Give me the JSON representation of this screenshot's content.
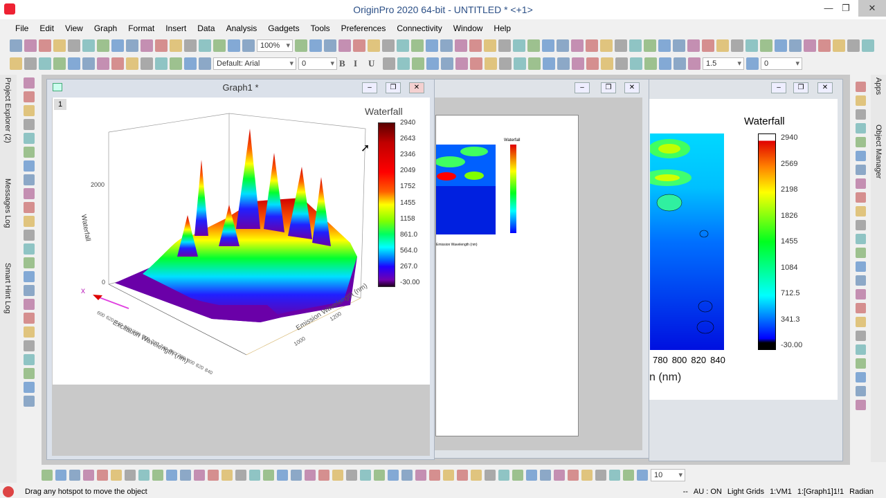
{
  "app": {
    "title": "OriginPro 2020 64-bit - UNTITLED * <+1>",
    "controls": [
      "—",
      "❐",
      "✕"
    ]
  },
  "menu": [
    "File",
    "Edit",
    "View",
    "Graph",
    "Format",
    "Insert",
    "Data",
    "Analysis",
    "Gadgets",
    "Tools",
    "Preferences",
    "Connectivity",
    "Window",
    "Help"
  ],
  "toolbar": {
    "zoom": "100%",
    "font": "Default: Arial",
    "font_size": "0",
    "line_width": "1.5",
    "value": "0",
    "bold": "B",
    "italic": "I",
    "underline": "U"
  },
  "side_tabs_left": [
    "Project Explorer (2)",
    "Messages Log",
    "Smart Hint Log"
  ],
  "side_tabs_right": [
    "Apps",
    "Object Manager"
  ],
  "graph1": {
    "title": "Graph1 *",
    "layer": "1",
    "colorbar_title": "Waterfall",
    "colorbar_ticks": [
      "2940",
      "2643",
      "2346",
      "2049",
      "1752",
      "1455",
      "1158",
      "861.0",
      "564.0",
      "267.0",
      "-30.00"
    ],
    "z_label": "Waterfall",
    "z_ticks": [
      "2000",
      "0"
    ],
    "x_label": "Excitation Wavelength (nm)",
    "x_ticks": [
      "600",
      "620",
      "640",
      "660",
      "680",
      "700",
      "720",
      "740",
      "760",
      "780",
      "800",
      "820",
      "840"
    ],
    "y_label": "Emission Wavelength (nm)",
    "y_ticks": [
      "1000",
      "1200"
    ],
    "axis_marker": "x",
    "colormap": [
      "#2a0040",
      "#6a00a8",
      "#0000ff",
      "#00ffff",
      "#00ff00",
      "#ffff00",
      "#ff8000",
      "#ff0000",
      "#6a0000"
    ]
  },
  "graph2": {
    "colorbar_title": "Waterfall",
    "x_label": "Emission Wavelength (nm)"
  },
  "graph3": {
    "colorbar_title": "Waterfall",
    "colorbar_ticks": [
      "2940",
      "2569",
      "2198",
      "1826",
      "1455",
      "1084",
      "712.5",
      "341.3",
      "-30.00"
    ],
    "x_ticks": [
      "780",
      "800",
      "820",
      "840"
    ],
    "x_label_fragment": "n (nm)"
  },
  "bottom_toolbar": {
    "font_size": "10"
  },
  "status": {
    "message": "Drag any hotspot to move the object",
    "items": [
      "--",
      "AU : ON",
      "Light Grids",
      "1:VM1",
      "1:[Graph1]1!1",
      "Radian"
    ]
  }
}
